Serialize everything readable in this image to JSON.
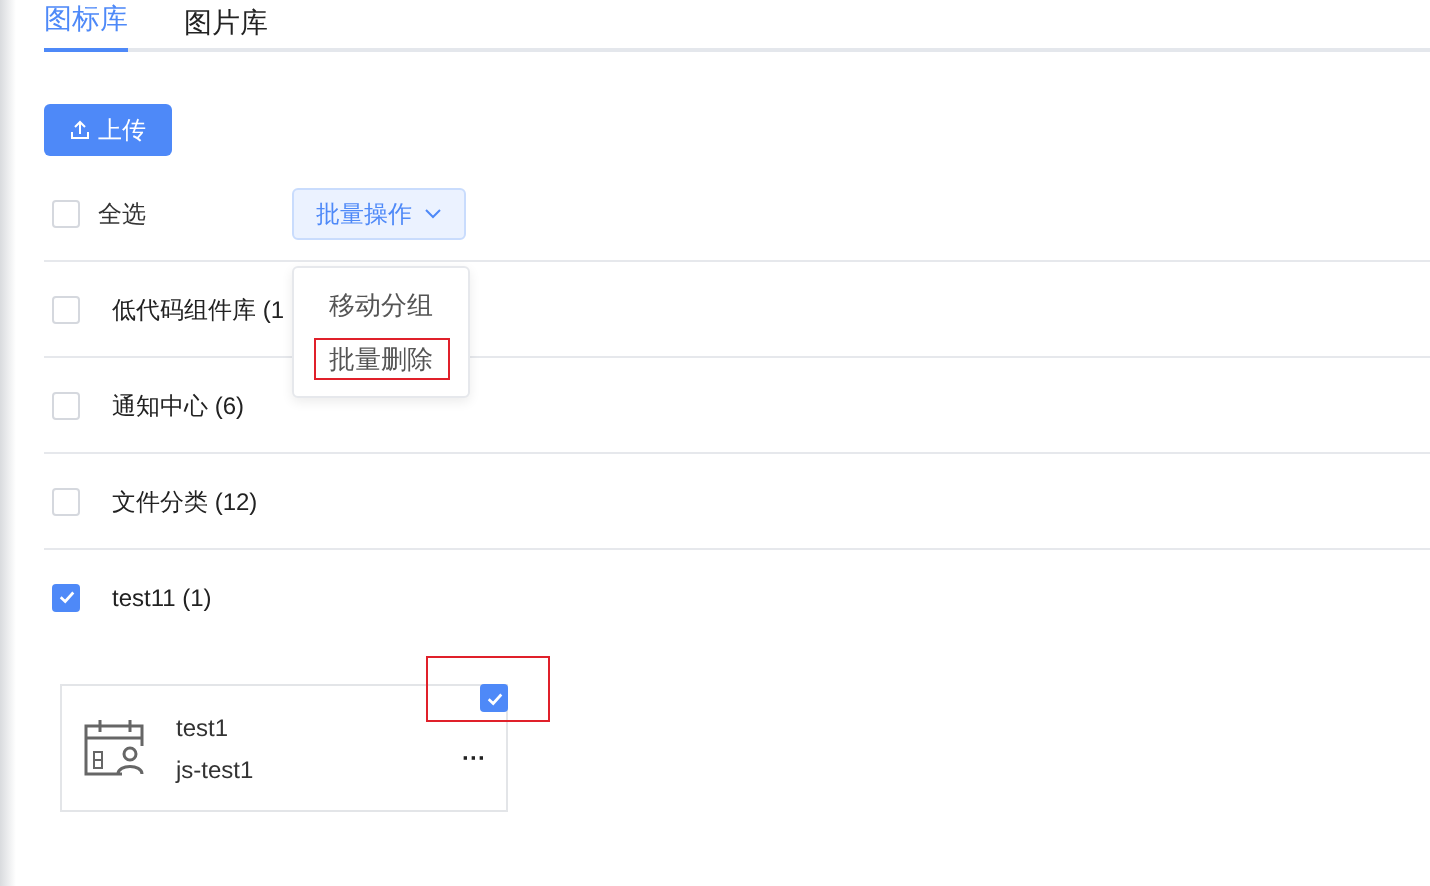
{
  "tabs": [
    {
      "label": "图标库",
      "selected": true
    },
    {
      "label": "图片库",
      "selected": false
    }
  ],
  "upload_button": "上传",
  "select_all": {
    "label": "全选",
    "checked": false
  },
  "batch_button": "批量操作",
  "batch_menu": [
    {
      "label": "移动分组",
      "highlighted": false
    },
    {
      "label": "批量删除",
      "highlighted": true
    }
  ],
  "groups": [
    {
      "label": "低代码组件库 (1",
      "checked": false
    },
    {
      "label": "通知中心 (6)",
      "checked": false
    },
    {
      "label": "文件分类 (12)",
      "checked": false
    },
    {
      "label": "test11 (1)",
      "checked": true
    }
  ],
  "icon_card": {
    "name": "test1",
    "code": "js-test1",
    "more": "···",
    "checked": true,
    "check_highlighted": true
  }
}
